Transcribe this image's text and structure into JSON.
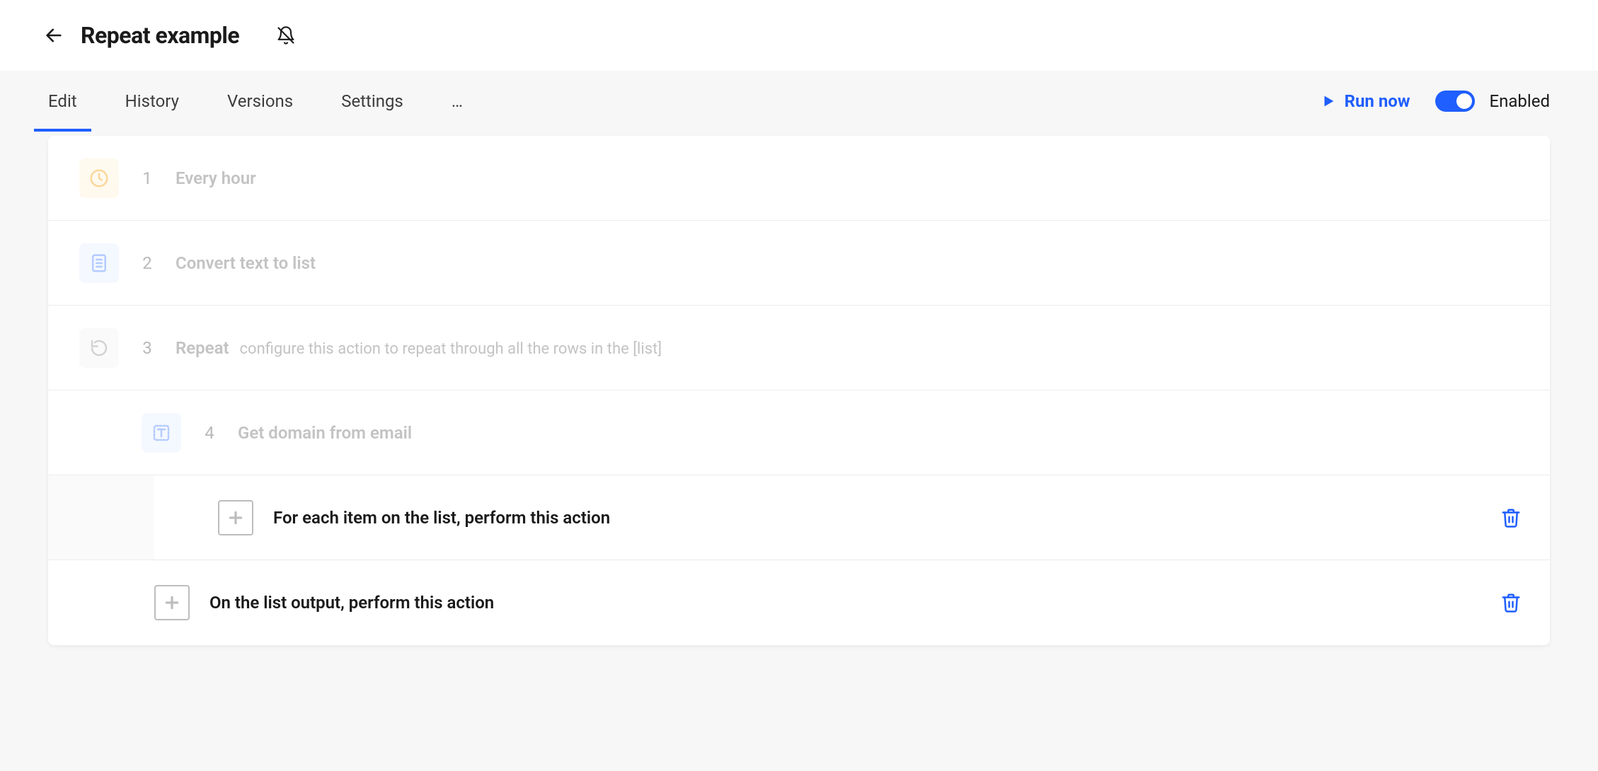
{
  "header": {
    "title": "Repeat example"
  },
  "tabs": {
    "items": [
      "Edit",
      "History",
      "Versions",
      "Settings"
    ],
    "more": "…"
  },
  "actions": {
    "run_now": "Run now",
    "enabled_label": "Enabled"
  },
  "steps": [
    {
      "num": "1",
      "title": "Every hour",
      "desc": ""
    },
    {
      "num": "2",
      "title": "Convert text to list",
      "desc": ""
    },
    {
      "num": "3",
      "title": "Repeat",
      "desc": "configure this action to repeat through all the rows in the [list]"
    },
    {
      "num": "4",
      "title": "Get domain from email",
      "desc": ""
    }
  ],
  "add_rows": {
    "nested": "For each item on the list, perform this action",
    "outer": "On the list output, perform this action"
  }
}
